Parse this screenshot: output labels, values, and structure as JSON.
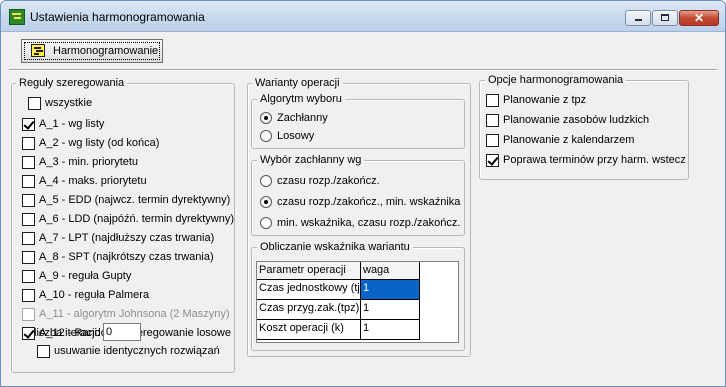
{
  "window": {
    "title": "Ustawienia harmonogramowania"
  },
  "toolbar": {
    "schedule_label": "Harmonogramowanie"
  },
  "rules": {
    "legend": "Reguły szeregowania",
    "all_label": "wszystkie",
    "items": [
      {
        "label": "A_1 - wg listy",
        "checked": true,
        "disabled": false
      },
      {
        "label": "A_2 - wg listy (od końca)",
        "checked": false,
        "disabled": false
      },
      {
        "label": "A_3 - min. priorytetu",
        "checked": false,
        "disabled": false
      },
      {
        "label": "A_4 - maks. priorytetu",
        "checked": false,
        "disabled": false
      },
      {
        "label": "A_5 - EDD (najwcz. termin dyrektywny)",
        "checked": false,
        "disabled": false
      },
      {
        "label": "A_6 - LDD (najpóźń. termin dyrektywny)",
        "checked": false,
        "disabled": false
      },
      {
        "label": "A_7 - LPT (najdłuższy czas trwania)",
        "checked": false,
        "disabled": false
      },
      {
        "label": "A_8 - SPT (najkrótszy czas trwania)",
        "checked": false,
        "disabled": false
      },
      {
        "label": "A_9 - reguła Gupty",
        "checked": false,
        "disabled": false
      },
      {
        "label": "A_10 - reguła Palmera",
        "checked": false,
        "disabled": false
      },
      {
        "label": "A_11 - algorytm Johnsona (2 Maszyny)",
        "checked": false,
        "disabled": true
      },
      {
        "label": "A_12 - Random - szeregowanie losowe",
        "checked": true,
        "disabled": false
      }
    ],
    "iterations_label": "liczba iteracji:",
    "iterations_value": "0",
    "remove_identical_label": "usuwanie identycznych rozwiązań"
  },
  "variants": {
    "legend": "Warianty operacji",
    "algorithm": {
      "legend": "Algorytm wyboru",
      "options": [
        {
          "label": "Zachłanny",
          "selected": true
        },
        {
          "label": "Losowy",
          "selected": false
        }
      ]
    },
    "greedy": {
      "legend": "Wybór zachłanny wg",
      "options": [
        {
          "label": "czasu rozp./zakończ.",
          "selected": false
        },
        {
          "label": "czasu rozp./zakończ., min. wskaźnika",
          "selected": true
        },
        {
          "label": "min. wskaźnika, czasu rozp./zakończ.",
          "selected": false
        }
      ]
    },
    "index": {
      "legend": "Obliczanie wskaźnika wariantu",
      "headers": [
        "Parametr operacji",
        "waga"
      ],
      "rows": [
        {
          "param": "Czas jednostkowy (tj)",
          "weight": "1"
        },
        {
          "param": "Czas przyg.zak.(tpz)",
          "weight": "1"
        },
        {
          "param": "Koszt operacji (k)",
          "weight": "1"
        }
      ]
    }
  },
  "options": {
    "legend": "Opcje harmonogramowania",
    "items": [
      {
        "label": "Planowanie z tpz",
        "checked": false
      },
      {
        "label": "Planowanie zasobów ludzkich",
        "checked": false
      },
      {
        "label": "Planowanie z kalendarzem",
        "checked": false
      },
      {
        "label": "Poprawa terminów przy harm. wstecz",
        "checked": true
      }
    ]
  }
}
